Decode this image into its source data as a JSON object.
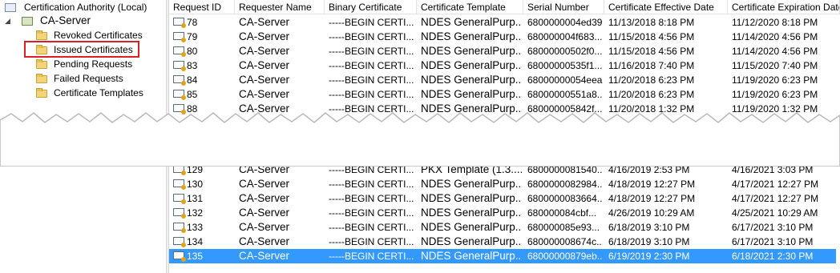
{
  "tree": {
    "root_label": "Certification Authority (Local)",
    "server_label": "CA-Server",
    "items": [
      {
        "label": "Revoked Certificates"
      },
      {
        "label": "Issued Certificates"
      },
      {
        "label": "Pending Requests"
      },
      {
        "label": "Failed Requests"
      },
      {
        "label": "Certificate Templates"
      }
    ]
  },
  "columns": [
    "Request ID",
    "Requester Name",
    "Binary Certificate",
    "Certificate Template",
    "Serial Number",
    "Certificate Effective Date",
    "Certificate Expiration Date"
  ],
  "rows_top": [
    {
      "id": "78",
      "requester": "CA-Server",
      "binary": "-----BEGIN CERTI...",
      "template": "NDES GeneralPurp...",
      "serial": "6800000004ed39...",
      "effective": "11/13/2018 8:18 PM",
      "expiration": "11/12/2020 8:18 PM"
    },
    {
      "id": "79",
      "requester": "CA-Server",
      "binary": "-----BEGIN CERTI...",
      "template": "NDES GeneralPurp...",
      "serial": "680000004f683...",
      "effective": "11/15/2018 4:56 PM",
      "expiration": "11/14/2020 4:56 PM"
    },
    {
      "id": "80",
      "requester": "CA-Server",
      "binary": "-----BEGIN CERTI...",
      "template": "NDES GeneralPurp...",
      "serial": "68000000502f0...",
      "effective": "11/15/2018 4:56 PM",
      "expiration": "11/14/2020 4:56 PM"
    },
    {
      "id": "83",
      "requester": "CA-Server",
      "binary": "-----BEGIN CERTI...",
      "template": "NDES GeneralPurp...",
      "serial": "68000000535f1...",
      "effective": "11/16/2018 7:40 PM",
      "expiration": "11/15/2020 7:40 PM"
    },
    {
      "id": "84",
      "requester": "CA-Server",
      "binary": "-----BEGIN CERTI...",
      "template": "NDES GeneralPurp...",
      "serial": "68000000054eea...",
      "effective": "11/20/2018 6:23 PM",
      "expiration": "11/19/2020 6:23 PM"
    },
    {
      "id": "85",
      "requester": "CA-Server",
      "binary": "-----BEGIN CERTI...",
      "template": "NDES GeneralPurp...",
      "serial": "68000000551a8...",
      "effective": "11/20/2018 6:23 PM",
      "expiration": "11/19/2020 6:23 PM"
    },
    {
      "id": "88",
      "requester": "CA-Server",
      "binary": "-----BEGIN CERTI...",
      "template": "NDES GeneralPurp...",
      "serial": "680000005842f...",
      "effective": "11/20/2018 1:32 PM",
      "expiration": "11/19/2020 1:32 PM"
    }
  ],
  "rows_bottom": [
    {
      "id": "129",
      "requester": "CA-Server",
      "binary": "-----BEGIN CERTI...",
      "template": "PKX Template (1.3....",
      "serial": "6800000081540...",
      "effective": "4/16/2019 2:53 PM",
      "expiration": "4/16/2021 3:03 PM"
    },
    {
      "id": "130",
      "requester": "CA-Server",
      "binary": "-----BEGIN CERTI...",
      "template": "NDES GeneralPurp...",
      "serial": "6800000082984...",
      "effective": "4/18/2019 12:27 PM",
      "expiration": "4/17/2021 12:27 PM"
    },
    {
      "id": "131",
      "requester": "CA-Server",
      "binary": "-----BEGIN CERTI...",
      "template": "NDES GeneralPurp...",
      "serial": "6800000083664...",
      "effective": "4/18/2019 12:27 PM",
      "expiration": "4/17/2021 12:27 PM"
    },
    {
      "id": "132",
      "requester": "CA-Server",
      "binary": "-----BEGIN CERTI...",
      "template": "NDES GeneralPurp...",
      "serial": "680000084cbf...",
      "effective": "4/26/2019 10:29 AM",
      "expiration": "4/25/2021 10:29 AM"
    },
    {
      "id": "133",
      "requester": "CA-Server",
      "binary": "-----BEGIN CERTI...",
      "template": "NDES GeneralPurp...",
      "serial": "680000085e93...",
      "effective": "6/18/2019 3:10 PM",
      "expiration": "6/17/2021 3:10 PM"
    },
    {
      "id": "134",
      "requester": "CA-Server",
      "binary": "-----BEGIN CERTI...",
      "template": "NDES GeneralPurp...",
      "serial": "680000008674c...",
      "effective": "6/18/2019 3:10 PM",
      "expiration": "6/17/2021 3:10 PM"
    },
    {
      "id": "135",
      "requester": "CA-Server",
      "binary": "-----BEGIN CERTI...",
      "template": "NDES GeneralPurp...",
      "serial": "68000000879eb...",
      "effective": "6/19/2019 2:30 PM",
      "expiration": "6/18/2021 2:30 PM"
    }
  ],
  "colors": {
    "selection": "#3399ff",
    "highlight_box": "#d92027"
  }
}
